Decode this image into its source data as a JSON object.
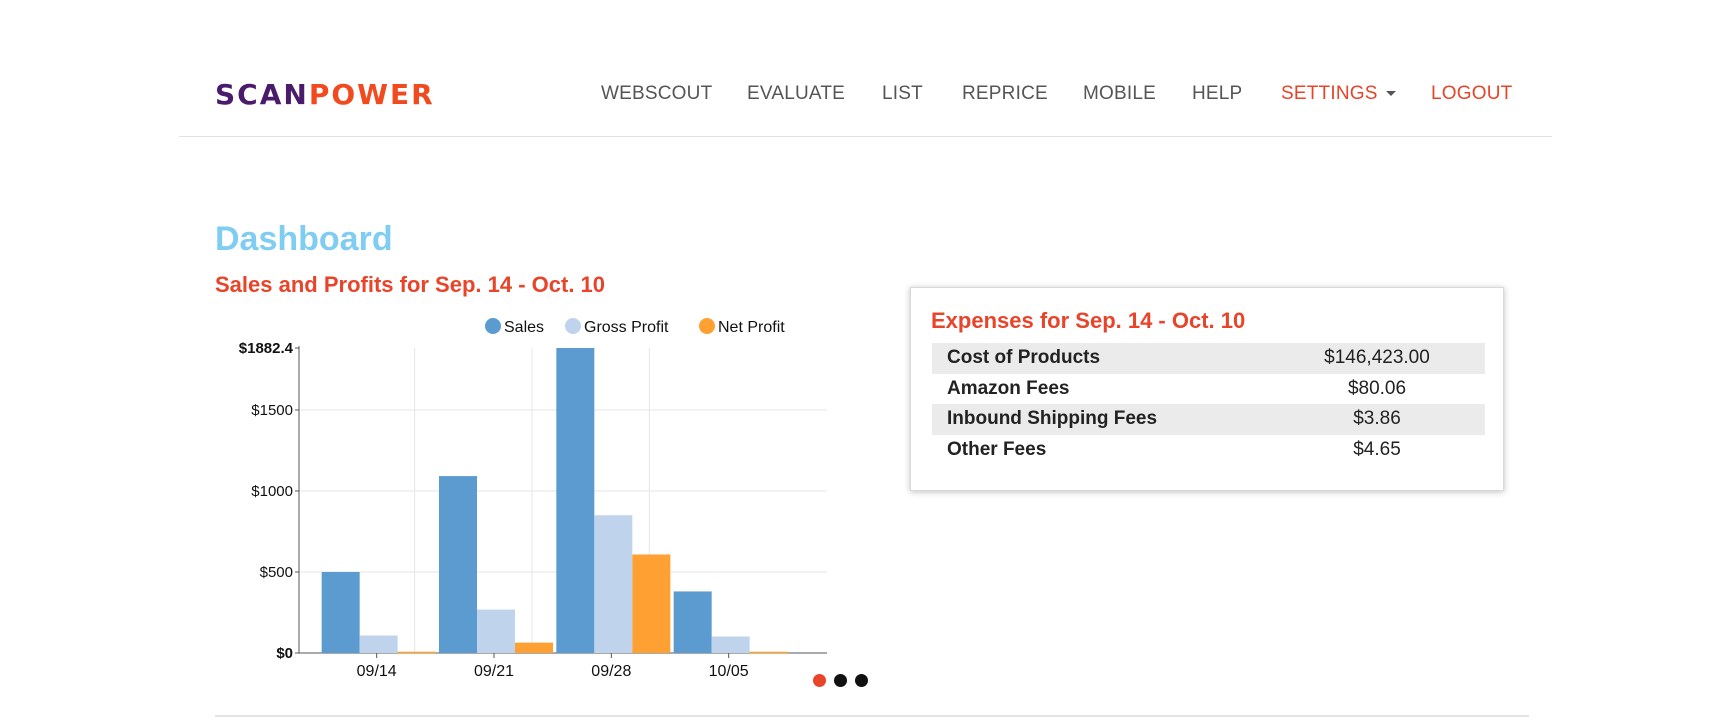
{
  "brand": {
    "part1": "SCAN",
    "part2": "POWER",
    "color1": "#4a1a6b",
    "color2": "#f04a1e"
  },
  "nav": {
    "items": [
      {
        "label": "WEBSCOUT",
        "color": "#555555"
      },
      {
        "label": "EVALUATE",
        "color": "#555555"
      },
      {
        "label": "LIST",
        "color": "#555555"
      },
      {
        "label": "REPRICE",
        "color": "#555555"
      },
      {
        "label": "MOBILE",
        "color": "#555555"
      },
      {
        "label": "HELP",
        "color": "#555555"
      }
    ],
    "settings_label": "SETTINGS",
    "logout_label": "LOGOUT",
    "accent_color": "#e8442a"
  },
  "page": {
    "title": "Dashboard",
    "title_color": "#7fcdf2"
  },
  "sales_panel": {
    "title": "Sales and Profits for Sep. 14 - Oct. 10"
  },
  "chart_data": {
    "type": "bar",
    "title": "Sales and Profits for Sep. 14 - Oct. 10",
    "categories": [
      "09/14",
      "09/21",
      "09/28",
      "10/05"
    ],
    "series": [
      {
        "name": "Sales",
        "values": [
          500,
          1092,
          1882.4,
          380
        ],
        "color": "#5b9bd0"
      },
      {
        "name": "Gross Profit",
        "values": [
          108,
          268,
          850,
          102
        ],
        "color": "#bfd3ed"
      },
      {
        "name": "Net Profit",
        "values": [
          8,
          64,
          608,
          8
        ],
        "color": "#ffa033"
      }
    ],
    "ylim": [
      0,
      1882.4
    ],
    "yticks": [
      {
        "value": 0,
        "label": "$0",
        "bold": true
      },
      {
        "value": 500,
        "label": "$500",
        "bold": false
      },
      {
        "value": 1000,
        "label": "$1000",
        "bold": false
      },
      {
        "value": 1500,
        "label": "$1500",
        "bold": false
      },
      {
        "value": 1882.4,
        "label": "$1882.4",
        "bold": true
      }
    ],
    "grid": true,
    "legend_position": "top",
    "xlabel": "",
    "ylabel": ""
  },
  "carousel": {
    "count": 3,
    "active_index": 0,
    "active_color": "#e8442a",
    "inactive_color": "#111111"
  },
  "expenses": {
    "title": "Expenses for Sep. 14 - Oct. 10",
    "rows": [
      {
        "label": "Cost of Products",
        "value": "$146,423.00"
      },
      {
        "label": "Amazon Fees",
        "value": "$80.06"
      },
      {
        "label": "Inbound Shipping Fees",
        "value": "$3.86"
      },
      {
        "label": "Other Fees",
        "value": "$4.65"
      }
    ]
  }
}
